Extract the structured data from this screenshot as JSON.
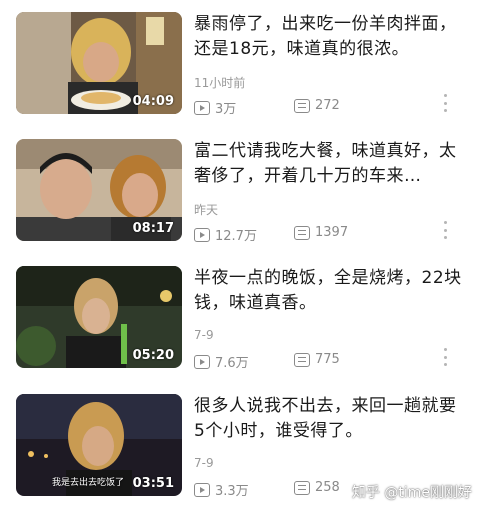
{
  "items": [
    {
      "title": "暴雨停了，出来吃一份羊肉拌面，还是18元，味道真的很浓。",
      "time": "11小时前",
      "views": "3万",
      "comments": "272",
      "duration": "04:09",
      "caption": ""
    },
    {
      "title": "富二代请我吃大餐，味道真好，太奢侈了，开着几十万的车来…",
      "time": "昨天",
      "views": "12.7万",
      "comments": "1397",
      "duration": "08:17",
      "caption": ""
    },
    {
      "title": "半夜一点的晚饭，全是烧烤，22块钱，味道真香。",
      "time": "7-9",
      "views": "7.6万",
      "comments": "775",
      "duration": "05:20",
      "caption": ""
    },
    {
      "title": "很多人说我不出去，来回一趟就要5个小时，谁受得了。",
      "time": "7-9",
      "views": "3.3万",
      "comments": "258",
      "duration": "03:51",
      "caption": "我是去出去吃饭了"
    }
  ],
  "watermark": "知乎 @time刚刚好",
  "icons": {
    "views": "play-count-icon",
    "comments": "comment-icon",
    "more": "more-vertical-icon"
  }
}
